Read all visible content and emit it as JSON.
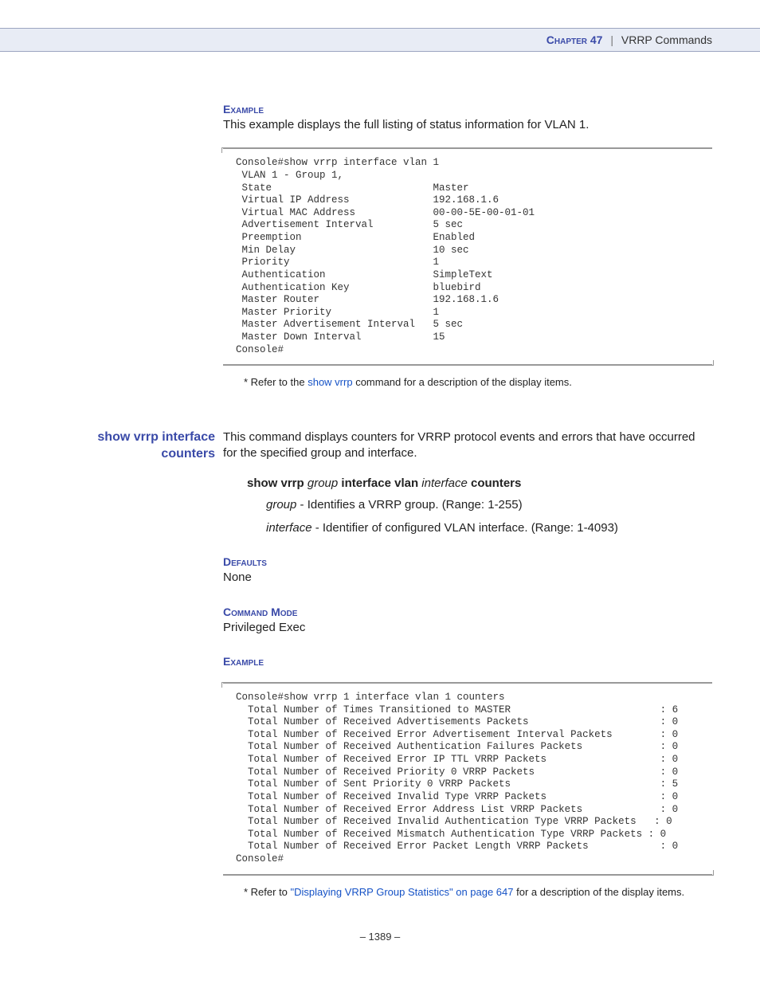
{
  "header": {
    "chapter": "Chapter 47",
    "title": "VRRP Commands"
  },
  "section1": {
    "heading": "Example",
    "intro": "This example displays the full listing of status information for VLAN 1.",
    "console": "Console#show vrrp interface vlan 1\n VLAN 1 - Group 1,\n State                           Master\n Virtual IP Address              192.168.1.6\n Virtual MAC Address             00-00-5E-00-01-01\n Advertisement Interval          5 sec\n Preemption                      Enabled\n Min Delay                       10 sec\n Priority                        1\n Authentication                  SimpleText\n Authentication Key              bluebird\n Master Router                   192.168.1.6\n Master Priority                 1\n Master Advertisement Interval   5 sec\n Master Down Interval            15\nConsole#",
    "note_prefix": "* Refer to the ",
    "note_link": "show vrrp",
    "note_suffix": " command for a description of the display items."
  },
  "command": {
    "name_line1": "show vrrp interface",
    "name_line2": "counters",
    "desc": "This command displays counters for VRRP protocol events and errors that have occurred for the specified group and interface.",
    "syntax": {
      "p1": "show vrrp ",
      "p2": "group",
      "p3": " interface vlan ",
      "p4": "interface",
      "p5": " counters"
    },
    "param1_name": "group",
    "param1_text": " - Identifies a VRRP group. (Range: 1-255)",
    "param2_name": "interface",
    "param2_text": " - Identifier of configured VLAN interface. (Range: 1-4093)",
    "defaults_head": "Defaults",
    "defaults_text": "None",
    "mode_head": "Command Mode",
    "mode_text": "Privileged Exec",
    "example_head": "Example",
    "console": "Console#show vrrp 1 interface vlan 1 counters\n  Total Number of Times Transitioned to MASTER                         : 6\n  Total Number of Received Advertisements Packets                      : 0\n  Total Number of Received Error Advertisement Interval Packets        : 0\n  Total Number of Received Authentication Failures Packets             : 0\n  Total Number of Received Error IP TTL VRRP Packets                   : 0\n  Total Number of Received Priority 0 VRRP Packets                     : 0\n  Total Number of Sent Priority 0 VRRP Packets                         : 5\n  Total Number of Received Invalid Type VRRP Packets                   : 0\n  Total Number of Received Error Address List VRRP Packets             : 0\n  Total Number of Received Invalid Authentication Type VRRP Packets   : 0\n  Total Number of Received Mismatch Authentication Type VRRP Packets : 0\n  Total Number of Received Error Packet Length VRRP Packets            : 0\nConsole#",
    "note2_prefix": "* Refer to ",
    "note2_link": "\"Displaying VRRP Group Statistics\" on page 647",
    "note2_suffix": " for a description of the display items."
  },
  "pagenum": "–  1389  –"
}
